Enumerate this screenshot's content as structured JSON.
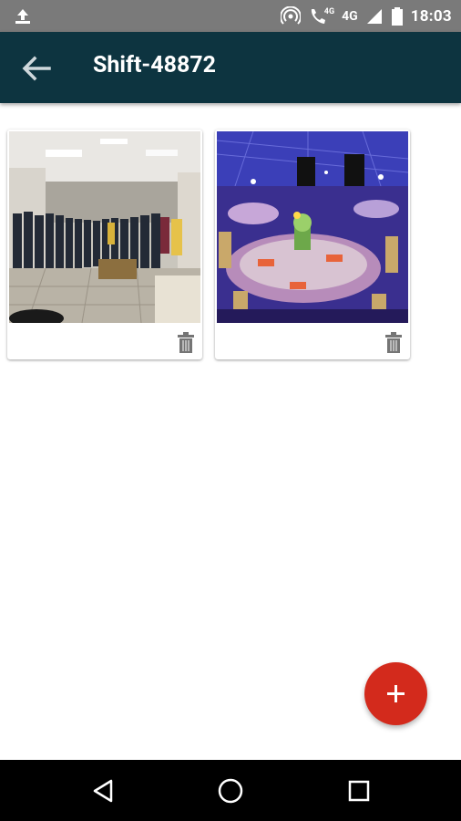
{
  "status_bar": {
    "time": "18:03",
    "network_label_1": "4G",
    "network_label_2": "4G",
    "icons": [
      "upload-icon",
      "hotspot-icon",
      "wifi-call-icon",
      "signal-icon",
      "battery-icon"
    ]
  },
  "app_bar": {
    "title": "Shift-48872",
    "back_icon": "arrow-back-icon"
  },
  "photos": [
    {
      "description_icon": "trash-icon"
    },
    {
      "description_icon": "trash-icon"
    }
  ],
  "fab": {
    "icon": "plus-icon",
    "color": "#d32a1c"
  },
  "nav_bar": {
    "icons": [
      "back-triangle-icon",
      "home-circle-icon",
      "recents-square-icon"
    ]
  },
  "colors": {
    "app_bar": "#0d3440",
    "status_bar": "#7a7a7a",
    "fab": "#d32a1c"
  }
}
